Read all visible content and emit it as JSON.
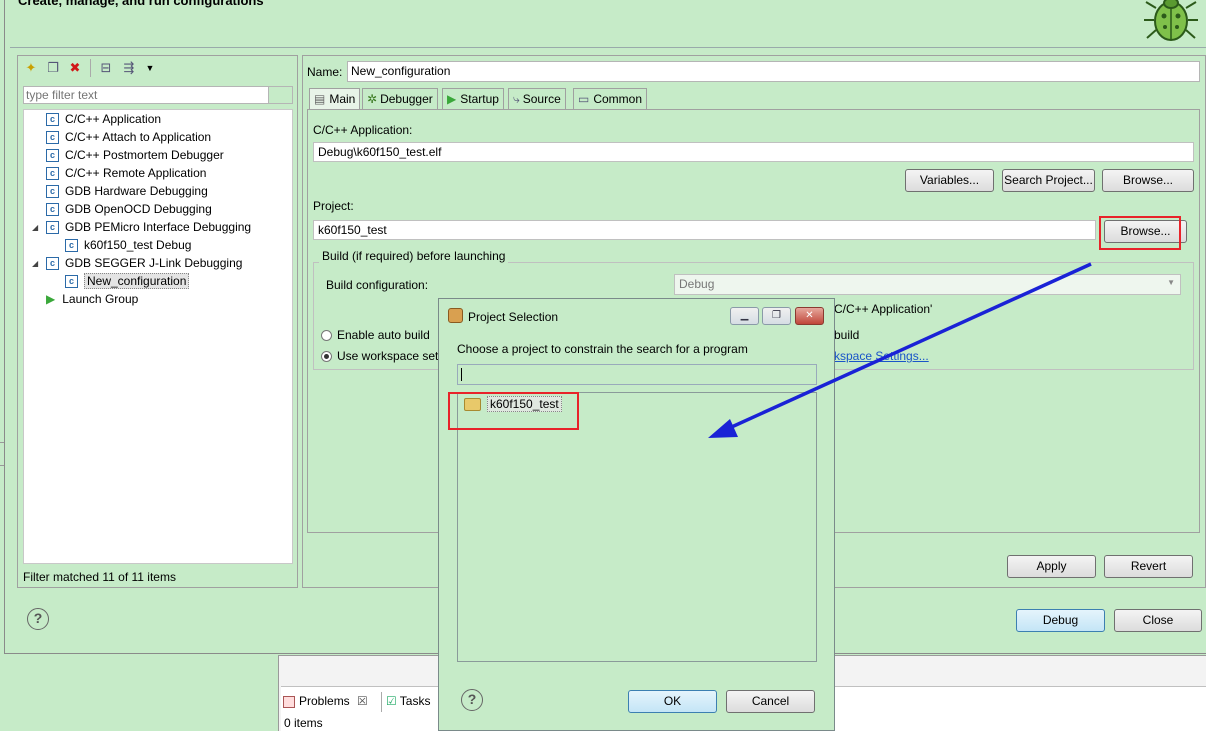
{
  "header": {
    "title": "Create, manage, and run configurations"
  },
  "left_panel": {
    "filter_placeholder": "type filter text",
    "tree": [
      {
        "label": "C/C++ Application",
        "icon": "c-config-icon"
      },
      {
        "label": "C/C++ Attach to Application",
        "icon": "c-config-icon"
      },
      {
        "label": "C/C++ Postmortem Debugger",
        "icon": "c-config-icon"
      },
      {
        "label": "C/C++ Remote Application",
        "icon": "c-config-icon"
      },
      {
        "label": "GDB Hardware Debugging",
        "icon": "c-config-icon"
      },
      {
        "label": "GDB OpenOCD Debugging",
        "icon": "c-config-icon"
      },
      {
        "label": "GDB PEMicro Interface Debugging",
        "icon": "c-config-icon",
        "expanded": true
      },
      {
        "label": "k60f150_test Debug",
        "icon": "c-config-icon"
      },
      {
        "label": "GDB SEGGER J-Link Debugging",
        "icon": "c-config-icon",
        "expanded": true
      },
      {
        "label": "New_configuration",
        "icon": "c-config-icon",
        "selected": true
      },
      {
        "label": "Launch Group",
        "icon": "launch-group-icon"
      }
    ],
    "status": "Filter matched 11 of 11 items"
  },
  "config": {
    "name_label": "Name:",
    "name_value": "New_configuration",
    "tabs": [
      "Main",
      "Debugger",
      "Startup",
      "Source",
      "Common"
    ],
    "app_label": "C/C++ Application:",
    "app_value": "Debug\\k60f150_test.elf",
    "variables_button": "Variables...",
    "search_project_button": "Search Project...",
    "browse_button": "Browse...",
    "project_label": "Project:",
    "project_value": "k60f150_test",
    "project_browse_button": "Browse...",
    "build_legend": "Build (if required) before launching",
    "build_config_label": "Build configuration:",
    "build_config_value": "Debug",
    "select_partial_text": "C/C++ Application'",
    "enable_auto_build": "Enable auto build",
    "disable_partial": "build",
    "use_workspace": "Use workspace sett",
    "workspace_link_partial": "kspace Settings...",
    "apply_button": "Apply",
    "revert_button": "Revert"
  },
  "footer": {
    "debug_button": "Debug",
    "close_button": "Close"
  },
  "project_dialog": {
    "title": "Project Selection",
    "prompt": "Choose a project to constrain the search for a program",
    "projects": [
      "k60f150_test"
    ],
    "ok_button": "OK",
    "cancel_button": "Cancel"
  },
  "bottom_view": {
    "problems_tab": "Problems",
    "tasks_tab": "Tasks",
    "items": "0 items"
  },
  "colors": {
    "background": "#c6ebc8",
    "annotation_red": "#e8232a",
    "annotation_arrow": "#1a22d6"
  }
}
